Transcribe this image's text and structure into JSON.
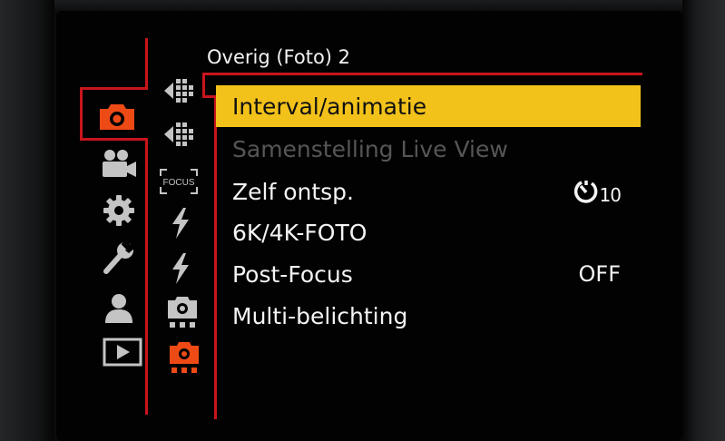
{
  "menu": {
    "title": "Overig (Foto) 2",
    "items": [
      {
        "label": "Interval/animatie",
        "value": "",
        "state": "selected"
      },
      {
        "label": "Samenstelling Live View",
        "value": "",
        "state": "disabled"
      },
      {
        "label": "Zelf ontsp.",
        "value": "10",
        "value_icon": "self-timer-icon",
        "state": "normal"
      },
      {
        "label": "6K/4K-FOTO",
        "value": "",
        "state": "normal"
      },
      {
        "label": "Post-Focus",
        "value": "OFF",
        "state": "normal"
      },
      {
        "label": "Multi-belichting",
        "value": "",
        "state": "normal"
      }
    ]
  },
  "main_tabs": [
    {
      "icon": "camera-icon",
      "active": true
    },
    {
      "icon": "video-camera-icon",
      "active": false
    },
    {
      "icon": "gear-icon",
      "active": false
    },
    {
      "icon": "wrench-icon",
      "active": false
    },
    {
      "icon": "person-icon",
      "active": false
    },
    {
      "icon": "playback-icon",
      "active": false
    }
  ],
  "sub_tabs": [
    {
      "icon": "image-quality-icon",
      "active": false
    },
    {
      "icon": "image-quality-icon",
      "active": false
    },
    {
      "icon": "focus-icon",
      "label": "FOCUS",
      "active": false
    },
    {
      "icon": "flash-icon",
      "active": false
    },
    {
      "icon": "flash-icon",
      "active": false
    },
    {
      "icon": "camera-other-icon",
      "active": false
    },
    {
      "icon": "camera-other-icon",
      "active": true
    }
  ],
  "colors": {
    "accent_red": "#c8151b",
    "active_orange": "#ee4a16",
    "highlight_yellow": "#f3c21a",
    "icon_grey": "#c4c4c4",
    "disabled_text": "#565656"
  }
}
